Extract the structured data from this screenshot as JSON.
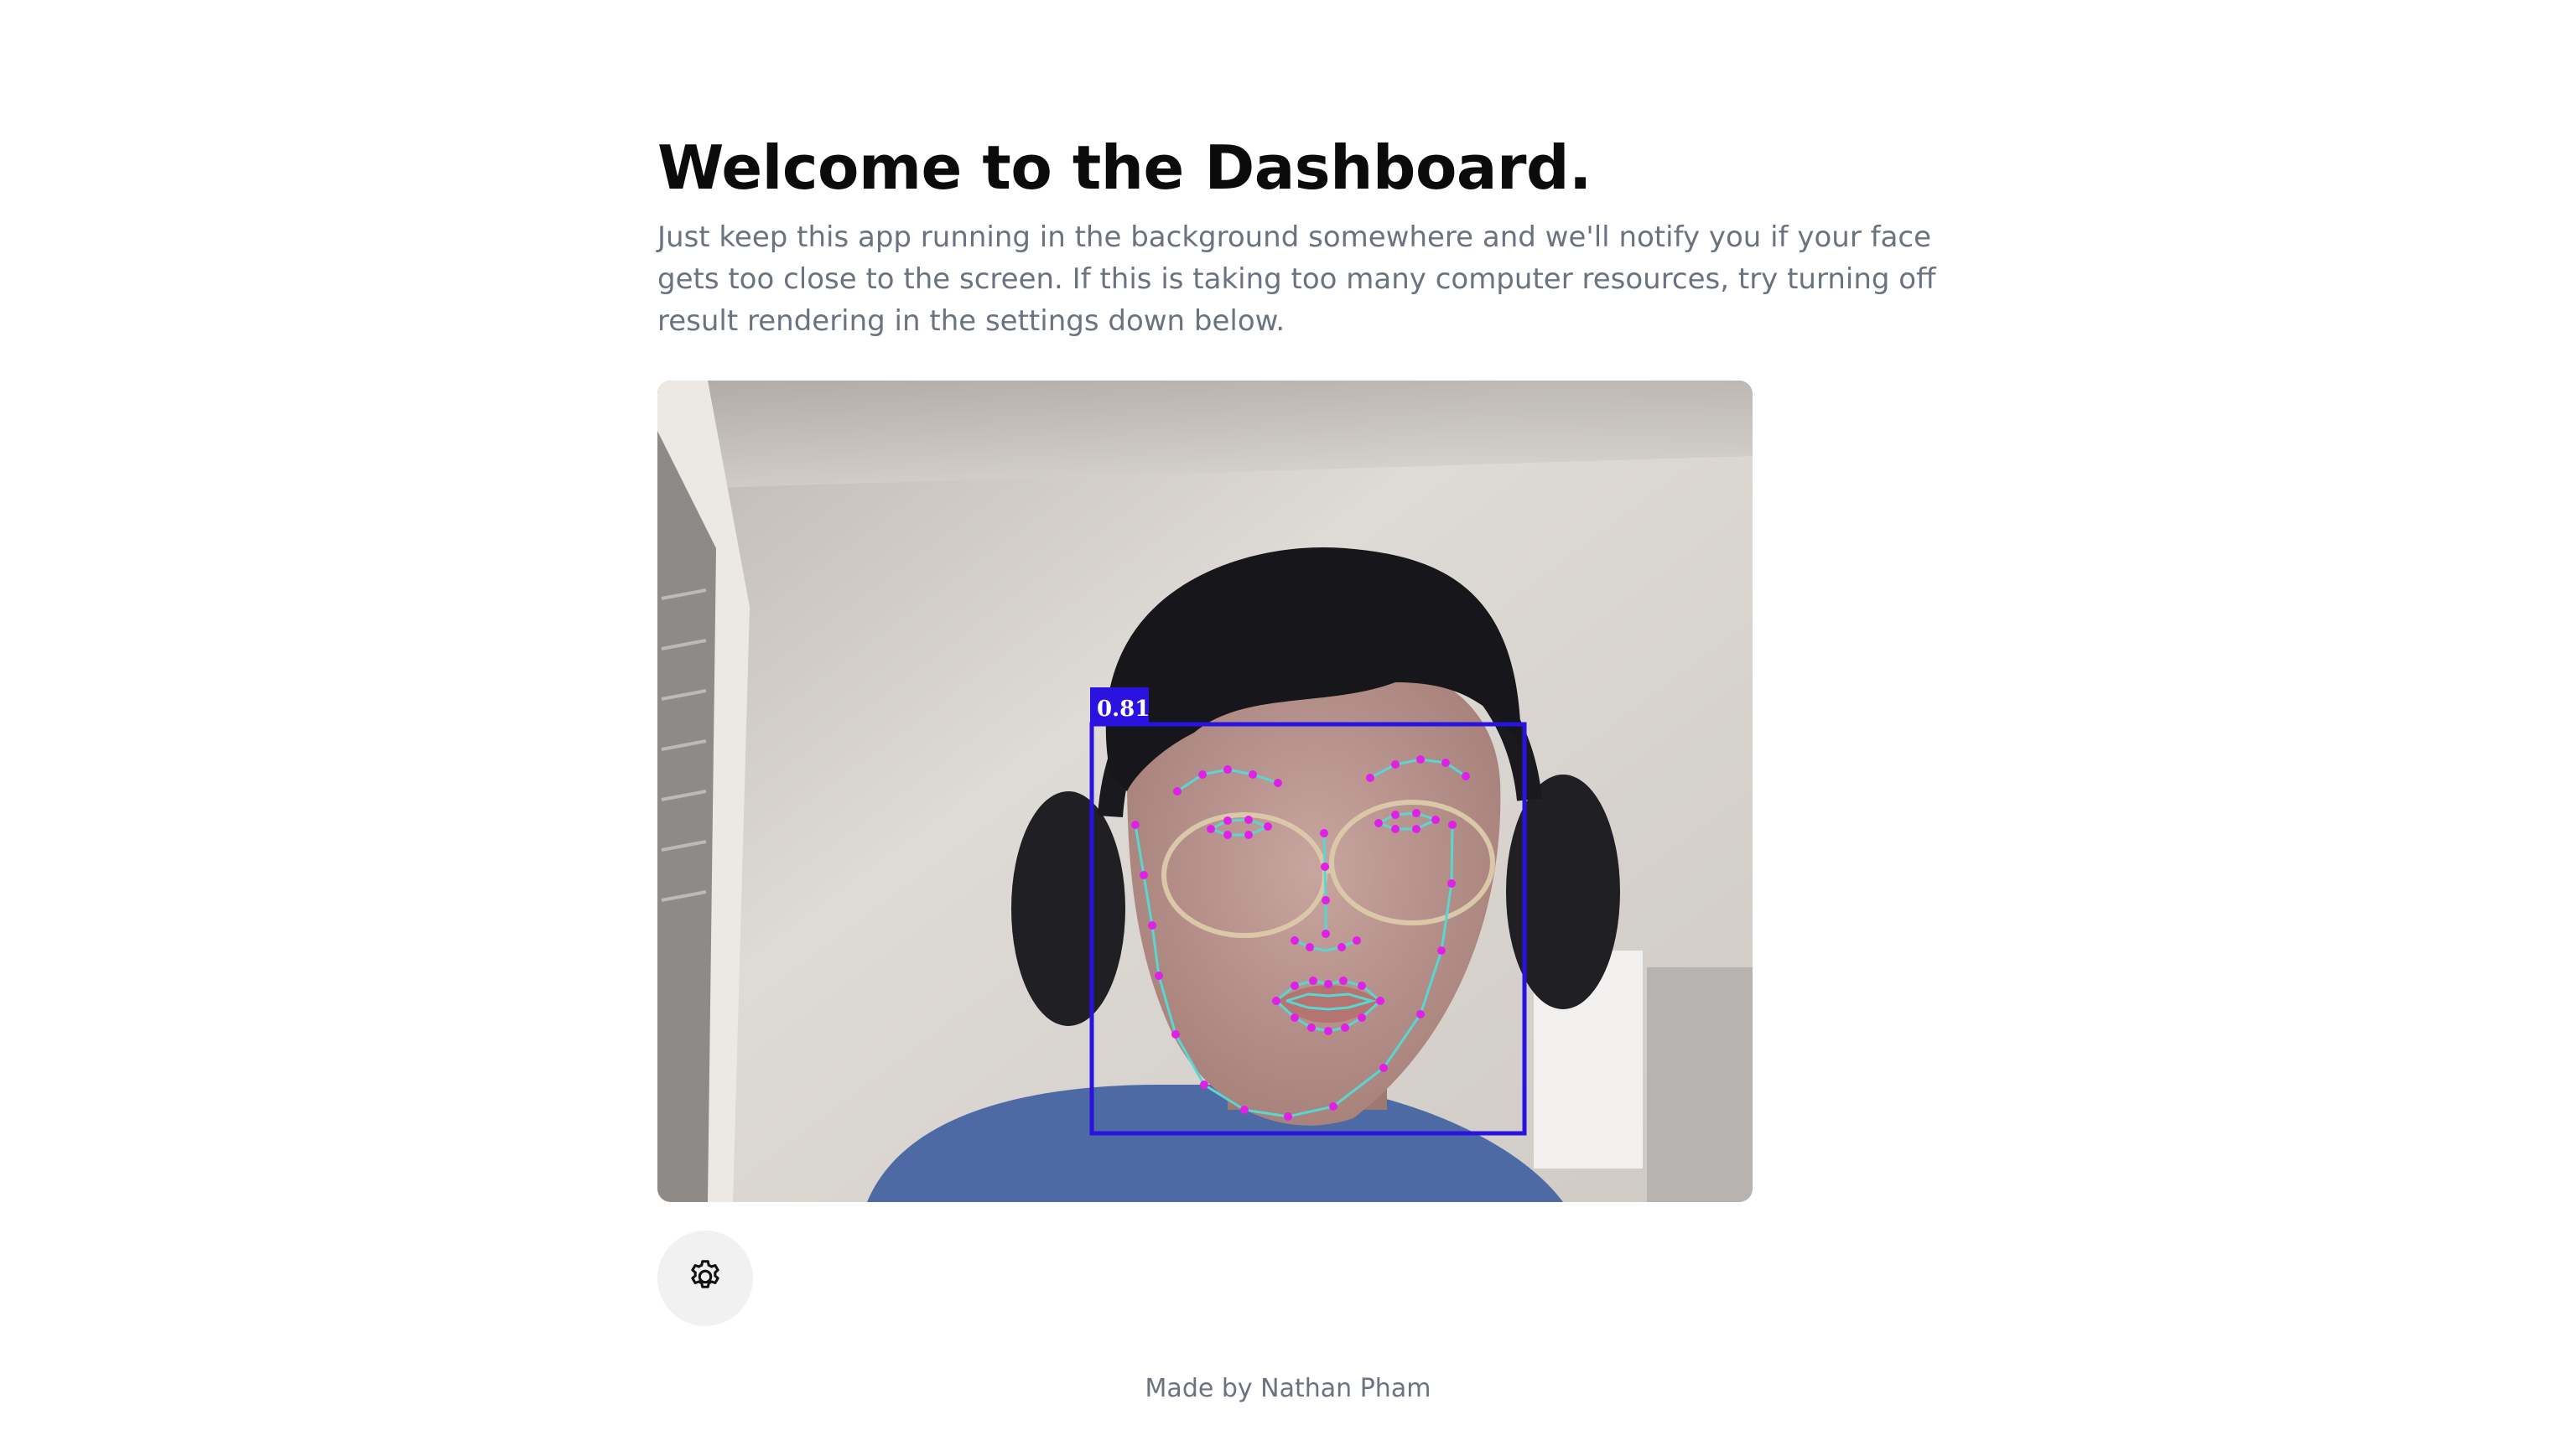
{
  "header": {
    "title": "Welcome to the Dashboard.",
    "description": "Just keep this app running in the background somewhere and we'll notify you if your face gets too close to the screen. If this is taking too many computer resources, try turning off result rendering in the settings down below."
  },
  "detection": {
    "confidence_label": "0.81",
    "box_color": "#2a12e0",
    "landmark_color": "#e020e8",
    "mesh_color": "#5ad6d0"
  },
  "settings": {
    "icon": "gear-icon"
  },
  "footer": {
    "text": "Made by Nathan Pham"
  }
}
